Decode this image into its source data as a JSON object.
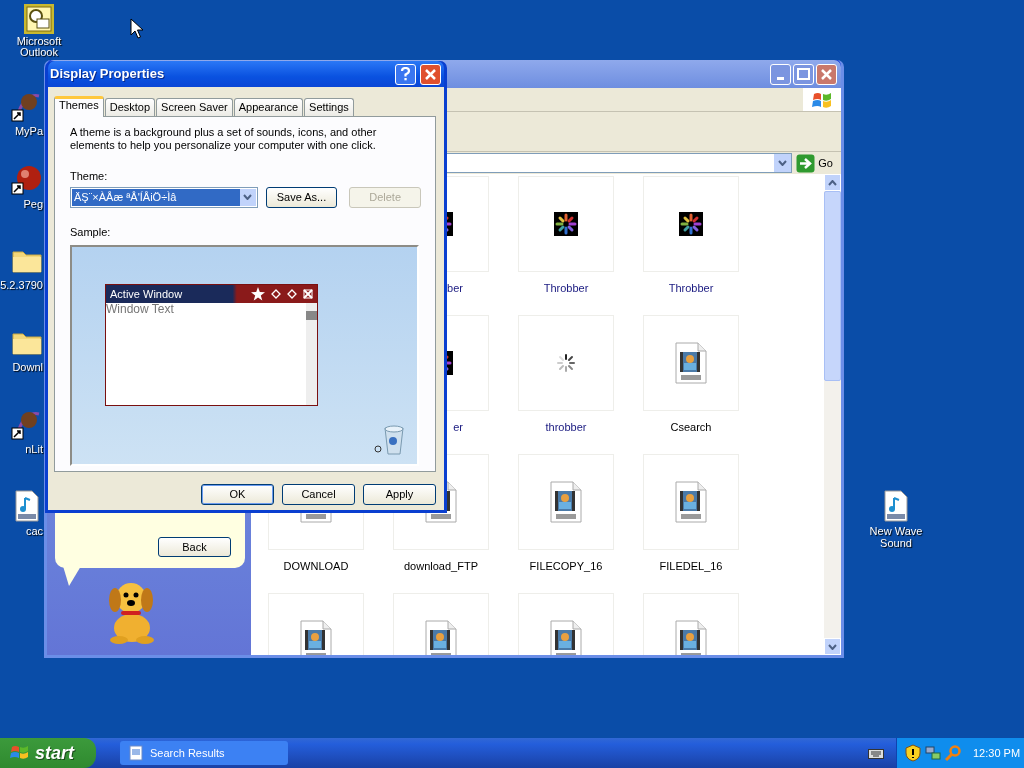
{
  "desktop_icons": [
    {
      "label": "Microsoft Outlook",
      "kind": "mail"
    },
    {
      "label": "MyPa",
      "kind": "app"
    },
    {
      "label": "Peg",
      "kind": "ball"
    },
    {
      "label": "5.2.3790",
      "kind": "folder"
    },
    {
      "label": "Downl",
      "kind": "folder"
    },
    {
      "label": "nLit",
      "kind": "app"
    },
    {
      "label": "cac",
      "kind": "sound"
    },
    {
      "label": "New Wave Sound",
      "kind": "sound"
    }
  ],
  "explorer": {
    "go_label": "Go",
    "panel_button": "Back",
    "rows": [
      {
        "items": [
          {
            "label": "ber",
            "kind": "throbber"
          },
          {
            "label": "Throbber",
            "kind": "throbber"
          },
          {
            "label": "Throbber",
            "kind": "throbber"
          }
        ]
      },
      {
        "items": [
          {
            "label": "er",
            "kind": "throbber"
          },
          {
            "label": "throbber",
            "kind": "spinner"
          },
          {
            "label": "Csearch",
            "kind": "avi"
          }
        ]
      },
      {
        "items": [
          {
            "label": "DOWNLOAD",
            "kind": "avi"
          },
          {
            "label": "download_FTP",
            "kind": "avi"
          },
          {
            "label": "FILECOPY_16",
            "kind": "avi"
          },
          {
            "label": "FILEDEL_16",
            "kind": "avi"
          }
        ]
      },
      {
        "items": [
          {
            "kind": "avi"
          },
          {
            "kind": "avi"
          },
          {
            "kind": "avi"
          },
          {
            "kind": "avi"
          }
        ]
      }
    ]
  },
  "dialog": {
    "title": "Display Properties",
    "tabs": [
      {
        "label": "Themes",
        "selected": true
      },
      {
        "label": "Desktop",
        "selected": false
      },
      {
        "label": "Screen Saver",
        "selected": false
      },
      {
        "label": "Appearance",
        "selected": false
      },
      {
        "label": "Settings",
        "selected": false
      }
    ],
    "description": "A theme is a background plus a set of sounds, icons, and other elements to help you personalize your computer with one click.",
    "theme_label": "Theme:",
    "theme_value": "ÄŞ¨×ÀÅæ ªÅ'ÍÅiÖ÷Ìâ",
    "theme_buttons": [
      {
        "label": "Save As...",
        "disabled": false
      },
      {
        "label": "Delete",
        "disabled": true
      }
    ],
    "sample_label": "Sample:",
    "sample": {
      "active_title": "Active Window",
      "window_text": "Window Text"
    },
    "buttons": [
      {
        "label": "OK",
        "default": true
      },
      {
        "label": "Cancel",
        "default": false
      },
      {
        "label": "Apply",
        "default": false
      }
    ]
  },
  "taskbar": {
    "start": "start",
    "tasks": [
      {
        "label": "Search Results",
        "selected": false
      }
    ],
    "clock": "12:30 PM"
  }
}
